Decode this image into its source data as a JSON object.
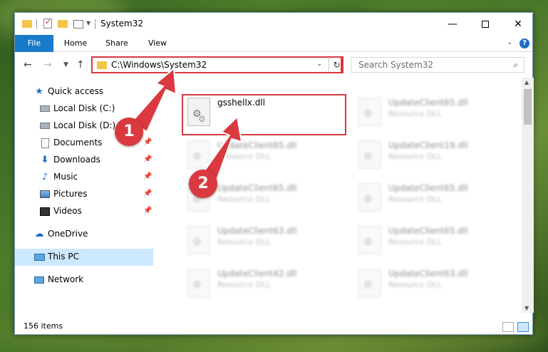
{
  "window": {
    "title": "System32"
  },
  "ribbon": {
    "tabs": [
      "File",
      "Home",
      "Share",
      "View"
    ]
  },
  "nav": {
    "address": "C:\\Windows\\System32",
    "search_placeholder": "Search System32"
  },
  "sidebar": {
    "items": [
      {
        "label": "Quick access",
        "icon": "star-icon",
        "pinned": false
      },
      {
        "label": "Local Disk (C:)",
        "icon": "drive-icon",
        "pinned": true
      },
      {
        "label": "Local Disk (D:)",
        "icon": "drive-icon",
        "pinned": true
      },
      {
        "label": "Documents",
        "icon": "documents-icon",
        "pinned": true
      },
      {
        "label": "Downloads",
        "icon": "download-icon",
        "pinned": true
      },
      {
        "label": "Music",
        "icon": "music-icon",
        "pinned": true
      },
      {
        "label": "Pictures",
        "icon": "pictures-icon",
        "pinned": true
      },
      {
        "label": "Videos",
        "icon": "videos-icon",
        "pinned": true
      },
      {
        "label": "OneDrive",
        "icon": "cloud-icon",
        "pinned": false
      },
      {
        "label": "This PC",
        "icon": "computer-icon",
        "pinned": false,
        "selected": true
      },
      {
        "label": "Network",
        "icon": "network-icon",
        "pinned": false
      }
    ]
  },
  "files": [
    {
      "name": "gsshellx.dll",
      "type": ""
    },
    {
      "name": "UpdateClient65.dll",
      "type": "Resource DLL"
    },
    {
      "name": "UpdateClient65.dll",
      "type": "Resource DLL"
    },
    {
      "name": "UpdateClient19.dll",
      "type": "Resource DLL"
    },
    {
      "name": "UpdateClient65.dll",
      "type": "Resource DLL"
    },
    {
      "name": "UpdateClient65.dll",
      "type": "Resource DLL"
    },
    {
      "name": "UpdateClient63.dll",
      "type": "Resource DLL"
    },
    {
      "name": "UpdateClient65.dll",
      "type": "Resource DLL"
    },
    {
      "name": "UpdateClient42.dll",
      "type": "Resource DLL"
    },
    {
      "name": "UpdateClient63.dll",
      "type": "Resource DLL"
    }
  ],
  "status": {
    "item_count": "156 items"
  },
  "annotations": {
    "badge1": "1",
    "badge2": "2"
  },
  "colors": {
    "accent": "#1979ca",
    "annotation": "#d9393f",
    "selection": "#cce8ff"
  }
}
